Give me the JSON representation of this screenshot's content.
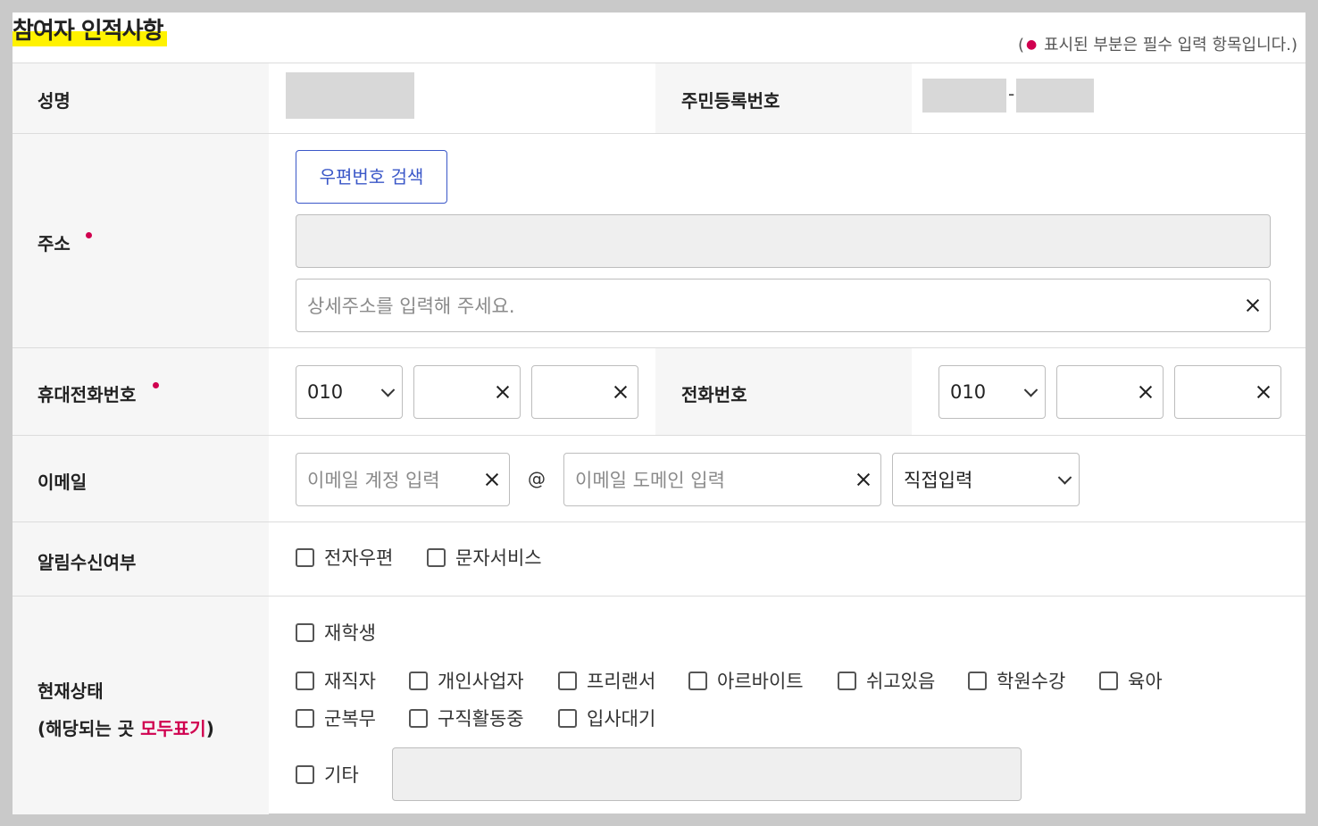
{
  "header": {
    "title": "참여자 인적사항",
    "required_note_open": "(",
    "required_note_dot": "●",
    "required_note_text": " 표시된 부분은 필수 입력 항목입니다.)"
  },
  "name_row": {
    "name_label": "성명",
    "rrn_label": "주민등록번호",
    "rrn_separator": "-"
  },
  "address_row": {
    "label": "주소",
    "zip_button": "우편번호 검색",
    "detail_placeholder": "상세주소를 입력해 주세요."
  },
  "mobile_row": {
    "label": "휴대전화번호",
    "prefix": "010",
    "phone_label": "전화번호",
    "phone_prefix": "010"
  },
  "email_row": {
    "label": "이메일",
    "account_placeholder": "이메일 계정 입력",
    "at": "@",
    "domain_placeholder": "이메일 도메인 입력",
    "domain_select": "직접입력"
  },
  "notify_row": {
    "label": "알림수신여부",
    "options": [
      "전자우편",
      "문자서비스"
    ]
  },
  "status_row": {
    "label_line1": "현재상태",
    "label_line2_prefix": "(해당되는 곳 ",
    "label_line2_emph": "모두표기",
    "label_line2_suffix": ")",
    "options_row1": [
      "재학생"
    ],
    "options_row2": [
      "재직자",
      "개인사업자",
      "프리랜서",
      "아르바이트",
      "쉬고있음",
      "학원수강",
      "육아"
    ],
    "options_row3": [
      "군복무",
      "구직활동중",
      "입사대기"
    ],
    "other": "기타"
  },
  "colors": {
    "accent_required": "#d0004f",
    "highlight": "#fff200",
    "zip_button": "#3a57c8"
  }
}
